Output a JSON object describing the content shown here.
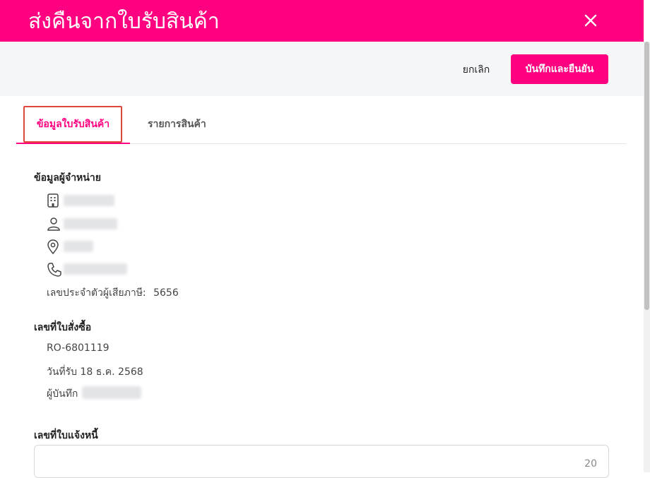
{
  "header": {
    "title": "ส่งคืนจากใบรับสินค้า"
  },
  "actions": {
    "cancel_label": "ยกเลิก",
    "save_label": "บันทึกและยืนยัน"
  },
  "tabs": [
    {
      "label": "ข้อมูลใบรับสินค้า",
      "active": true
    },
    {
      "label": "รายการสินค้า",
      "active": false
    }
  ],
  "supplier": {
    "section_title": "ข้อมูลผู้จำหน่าย",
    "tax_id_label": "เลขประจำตัวผู้เสียภาษี:",
    "tax_id_value": "5656"
  },
  "purchase_order": {
    "section_title": "เลขที่ใบสั่งซื้อ",
    "number": "RO-6801119",
    "received_date": "วันที่รับ 18 ธ.ค. 2568",
    "recorder_label": "ผู้บันทึก"
  },
  "credit_note": {
    "section_title": "เลขที่ใบแจ้งหนี้",
    "counter": "20"
  },
  "colors": {
    "brand": "#ff0080",
    "focus_ring": "#e0483e"
  }
}
